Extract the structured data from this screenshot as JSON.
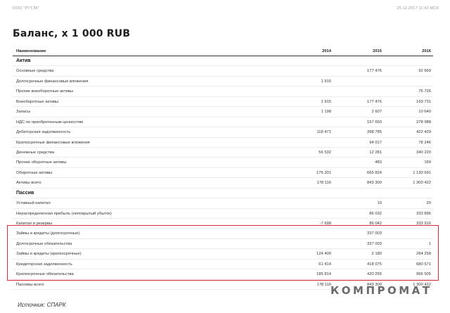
{
  "top": {
    "company": "ООО \"РУТЭК\"",
    "timestamp": "25.12.2017 11:43 МСК"
  },
  "title": "Баланс, x 1 000 RUB",
  "table": {
    "columns": [
      "Наименование",
      "2014",
      "2015",
      "2016"
    ],
    "rows": [
      {
        "type": "section",
        "name": "Актив",
        "v": [
          "",
          "",
          ""
        ]
      },
      {
        "type": "row",
        "name": "Основные средства",
        "v": [
          "",
          "177 476",
          "92 669"
        ]
      },
      {
        "type": "row",
        "name": "Долгосрочные финансовые вложения",
        "v": [
          "1 915",
          "",
          ""
        ]
      },
      {
        "type": "row",
        "name": "Прочие внеоборотные активы",
        "v": [
          "",
          "",
          "76 726"
        ]
      },
      {
        "type": "row",
        "name": "Внеоборотные активы",
        "v": [
          "1 915",
          "177 476",
          "169 731"
        ]
      },
      {
        "type": "row",
        "name": "Запасы",
        "v": [
          "1 198",
          "2 607",
          "10 640"
        ]
      },
      {
        "type": "row",
        "name": "НДС по приобретенным ценностям",
        "v": [
          "",
          "157 650",
          "278 988"
        ]
      },
      {
        "type": "row",
        "name": "Дебиторская задолженность",
        "v": [
          "118 471",
          "398 785",
          "422 429"
        ]
      },
      {
        "type": "row",
        "name": "Краткосрочные финансовые вложения",
        "v": [
          "",
          "94 017",
          "78 246"
        ]
      },
      {
        "type": "row",
        "name": "Денежные средства",
        "v": [
          "56 532",
          "12 281",
          "340 220"
        ]
      },
      {
        "type": "row",
        "name": "Прочие оборотные активы",
        "v": [
          "",
          "483",
          "169"
        ]
      },
      {
        "type": "row",
        "name": "Оборотные активы",
        "v": [
          "176 201",
          "665 824",
          "1 130 691"
        ]
      },
      {
        "type": "row",
        "name": "Активы всего",
        "v": [
          "178 116",
          "843 300",
          "1 300 422"
        ]
      },
      {
        "type": "section",
        "name": "Пассив",
        "v": [
          "",
          "",
          ""
        ]
      },
      {
        "type": "row",
        "name": "Уставный капитал",
        "v": [
          "",
          "10",
          "20"
        ]
      },
      {
        "type": "row",
        "name": "Нераспределенная прибыль (непокрытый убыток)",
        "v": [
          "",
          "86 032",
          "333 896"
        ]
      },
      {
        "type": "row",
        "name": "Капитал и резервы",
        "v": [
          "-7 698",
          "86 042",
          "333 916"
        ]
      },
      {
        "type": "row",
        "name": "Займы и кредиты (долгосрочные)",
        "v": [
          "",
          "337 003",
          ""
        ]
      },
      {
        "type": "row",
        "name": "Долгосрочные обязательства",
        "v": [
          "",
          "337 003",
          "1"
        ]
      },
      {
        "type": "row",
        "name": "Займы и кредиты (краткосрочные)",
        "v": [
          "124 400",
          "2 180",
          "284 258"
        ]
      },
      {
        "type": "row",
        "name": "Кредиторская задолженность",
        "v": [
          "61 414",
          "418 075",
          "680 571"
        ]
      },
      {
        "type": "row",
        "name": "Краткосрочные обязательства",
        "v": [
          "185 814",
          "420 255",
          "966 505"
        ]
      },
      {
        "type": "row",
        "name": "Пассивы всего",
        "v": [
          "178 116",
          "843 300",
          "1 300 422"
        ]
      }
    ]
  },
  "source": "Источник: СПАРК",
  "watermark": "КОМПРОМАТ",
  "colors": {
    "highlight": "#d62b3a"
  }
}
